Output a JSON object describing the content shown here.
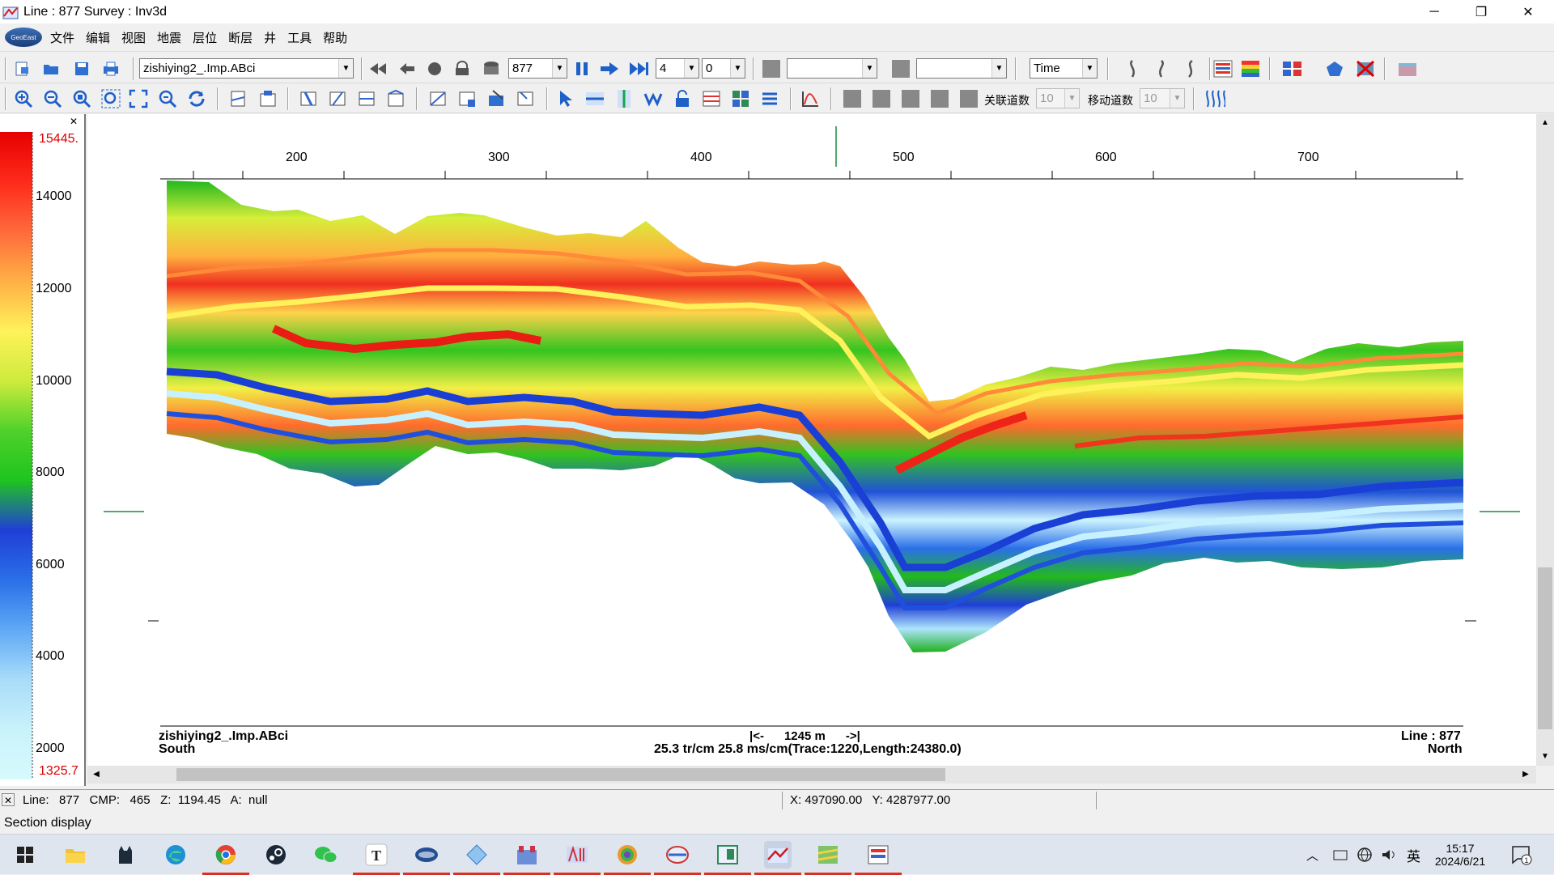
{
  "window": {
    "title": "Line : 877  Survey : Inv3d",
    "controls": [
      "─",
      "❐",
      "✕"
    ]
  },
  "menu": {
    "logo_text": "GeoEast",
    "items": [
      "文件",
      "编辑",
      "视图",
      "地震",
      "层位",
      "断层",
      "井",
      "工具",
      "帮助"
    ]
  },
  "toolbar1": {
    "dataset": "zishiying2_.Imp.ABci",
    "line_value": "877",
    "step_value": "4",
    "offset_value": "0",
    "combo_a": "",
    "combo_b": "",
    "domain": "Time"
  },
  "toolbar2": {
    "label_assoc": "关联道数",
    "assoc_value": "10",
    "label_move": "移动道数",
    "move_value": "10"
  },
  "colorbar": {
    "max_label": "15445.",
    "min_label": "1325.7",
    "ticks": [
      "14000",
      "12000",
      "10000",
      "8000",
      "6000",
      "4000",
      "2000"
    ],
    "colors": [
      "#e60000",
      "#ff2a1a",
      "#ff6a3c",
      "#ffb045",
      "#fff25a",
      "#cdeb3c",
      "#4fd12a",
      "#1fc41f",
      "#1f3fd6",
      "#2a6fe8",
      "#5fa9f5",
      "#a9dcf9",
      "#c9f2fa",
      "#d6fbfd"
    ]
  },
  "section": {
    "cmp_ticks": [
      "200",
      "300",
      "400",
      "500",
      "600",
      "700"
    ],
    "dataset_label": "zishiying2_.Imp.ABci",
    "left_dir": "South",
    "right_line": "Line : 877",
    "right_dir": "North",
    "scale_bar": "|<-      1245 m      ->|",
    "scale_info": "25.3 tr/cm 25.8 ms/cm(Trace:1220,Length:24380.0)"
  },
  "status": {
    "left": "Line:   877   CMP:   465   Z:  1194.45   A:  null",
    "right": "X: 497090.00   Y: 4287977.00",
    "hint": "Section display"
  },
  "taskbar": {
    "apps": [
      "start",
      "file-explorer",
      "app-cat",
      "edge",
      "chrome",
      "steam",
      "wechat",
      "typora",
      "geoeast",
      "app-diamond",
      "app-castle",
      "app-ai",
      "app-blob",
      "app-search",
      "app-window",
      "app-seismic",
      "app-map",
      "app-panel"
    ],
    "tray_lang": "英",
    "time": "15:17",
    "date": "2024/6/21",
    "notification_count": "1"
  }
}
